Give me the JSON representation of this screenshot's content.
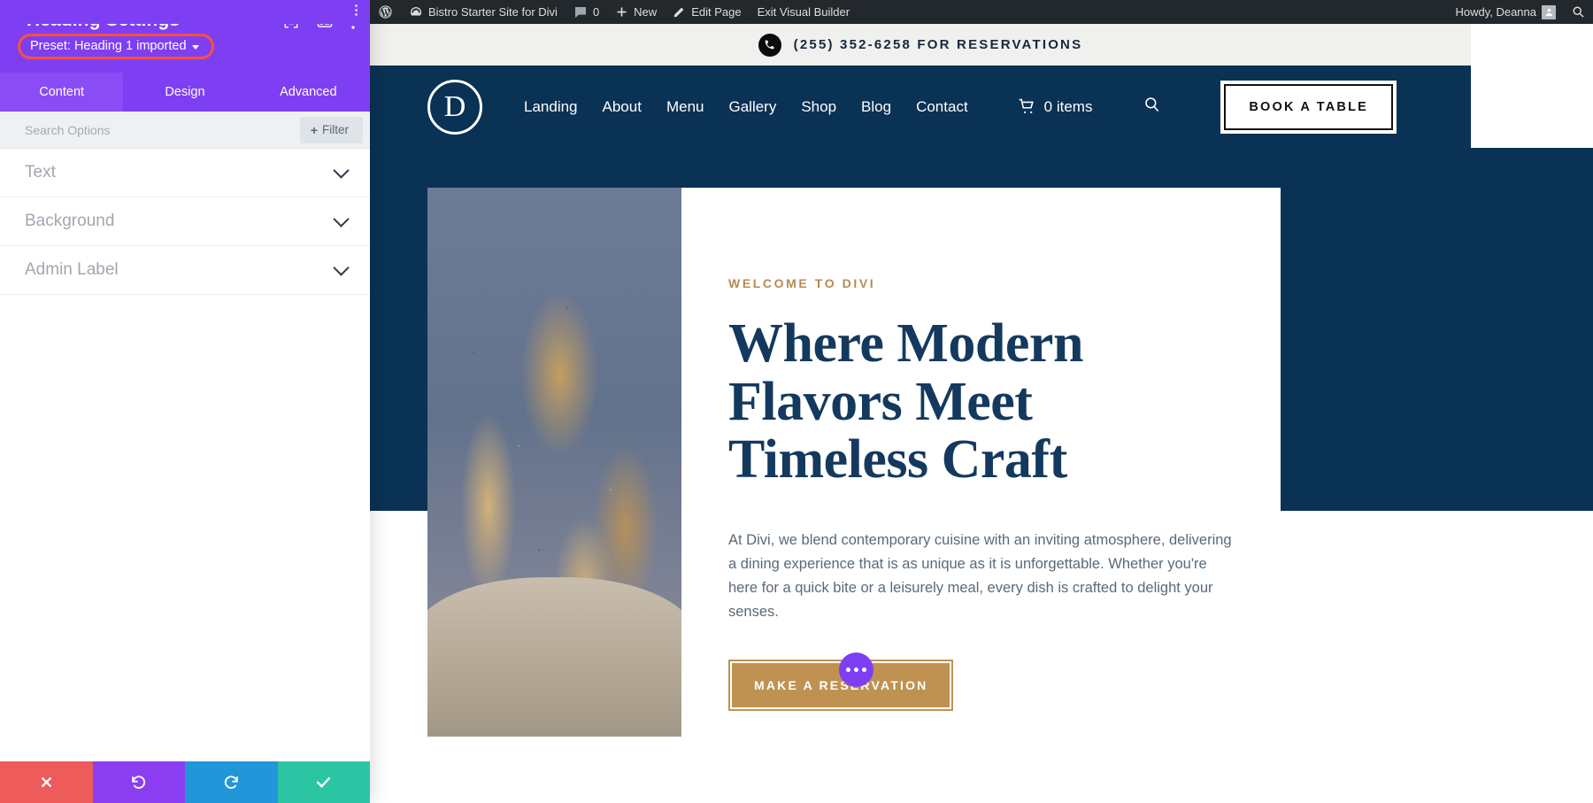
{
  "settings_panel": {
    "title": "Heading Settings",
    "preset_label": "Preset: Heading 1 imported",
    "header_icons": [
      {
        "name": "focus-target-icon"
      },
      {
        "name": "layout-columns-icon"
      },
      {
        "name": "kebab-menu-icon"
      }
    ],
    "tabs": [
      {
        "label": "Content",
        "active": true
      },
      {
        "label": "Design",
        "active": false
      },
      {
        "label": "Advanced",
        "active": false
      }
    ],
    "search_placeholder": "Search Options",
    "filter_label": "Filter",
    "filter_plus": "+",
    "sections": [
      {
        "label": "Text"
      },
      {
        "label": "Background"
      },
      {
        "label": "Admin Label"
      }
    ],
    "footer_buttons": [
      {
        "name": "cancel",
        "glyph": "✕",
        "color": "#ed5b5b"
      },
      {
        "name": "undo",
        "glyph": "↺",
        "color": "#8b3ef0"
      },
      {
        "name": "redo",
        "glyph": "↻",
        "color": "#2196d9"
      },
      {
        "name": "save",
        "glyph": "✔",
        "color": "#2bc5a3"
      }
    ],
    "highlight_color": "#ff4f3f",
    "accent_color": "#7e3ff2"
  },
  "admin_bar": {
    "wp_logo": "ⓦ",
    "site_name": "Bistro Starter Site for Divi",
    "comments_count": "0",
    "new_label": "New",
    "edit_page_label": "Edit Page",
    "exit_builder_label": "Exit Visual Builder",
    "howdy": "Howdy, Deanna"
  },
  "site": {
    "topbar": {
      "phone_text": "(255) 352-6258 FOR RESERVATIONS"
    },
    "nav": {
      "logo_letter": "D",
      "links": [
        "Landing",
        "About",
        "Menu",
        "Gallery",
        "Shop",
        "Blog",
        "Contact"
      ],
      "cart_label": "0 items",
      "cta_label": "BOOK A TABLE"
    },
    "hero": {
      "eyebrow": "WELCOME TO DIVI",
      "heading_line1": "Where Modern",
      "heading_line2": "Flavors Meet",
      "heading_line3": "Timeless Craft",
      "paragraph": "At Divi, we blend contemporary cuisine with an inviting atmosphere, delivering a dining experience that is as unique as it is unforgettable. Whether you're here for a quick bite or a leisurely meal, every dish is crafted to delight your senses.",
      "cta_label": "MAKE A RESERVATION",
      "image_alt": "seeded breadsticks in a paper bag"
    },
    "colors": {
      "navy": "#0a3254",
      "gold": "#bf9252",
      "heading": "#14395e"
    }
  }
}
